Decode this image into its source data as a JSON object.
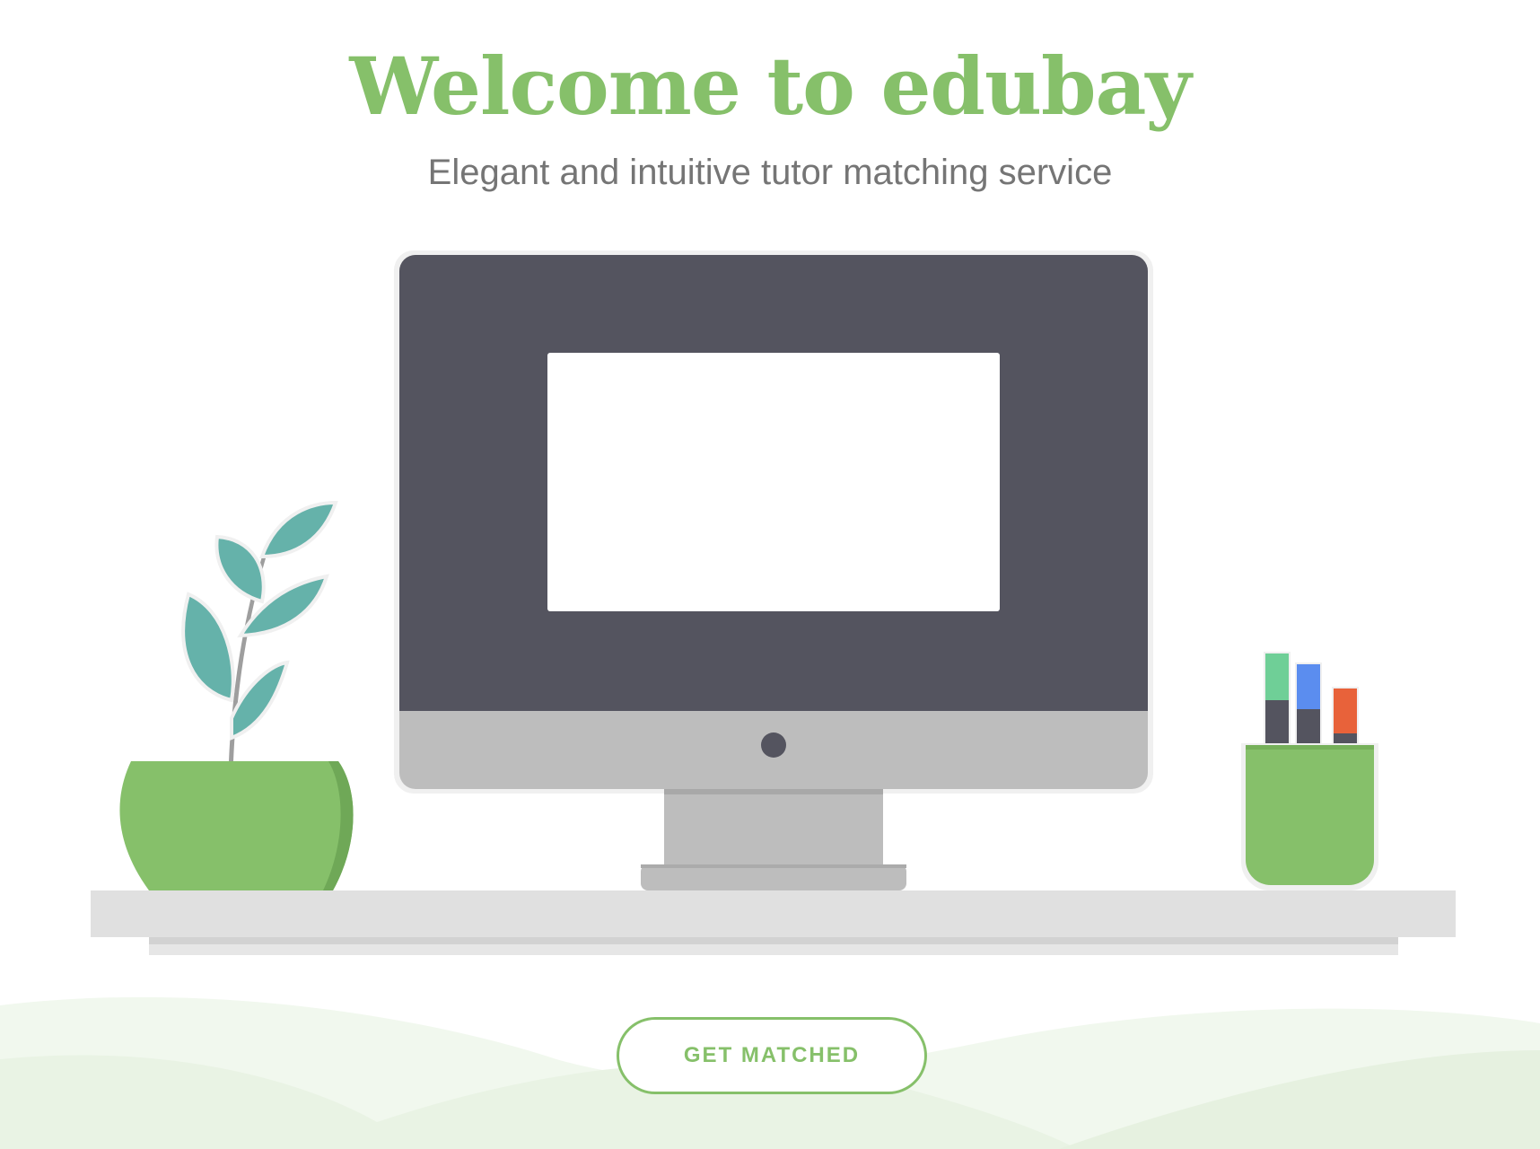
{
  "hero": {
    "title": "Welcome to edubay",
    "subtitle": "Elegant and intuitive tutor matching service"
  },
  "cta": {
    "label": "GET MATCHED"
  },
  "illustration": {
    "items": [
      "monitor",
      "potted-plant",
      "pen-cup",
      "desk-shelf"
    ]
  },
  "colors": {
    "brand_green": "#86c06a",
    "subtitle_gray": "#757575",
    "monitor_body": "#54545f",
    "monitor_chin": "#bdbdbd",
    "leaf": "#65b2aa",
    "pen_green": "#6fcf97",
    "pen_blue": "#5b8def",
    "pen_red": "#e8623a",
    "hill_light": "#eef6ea"
  }
}
